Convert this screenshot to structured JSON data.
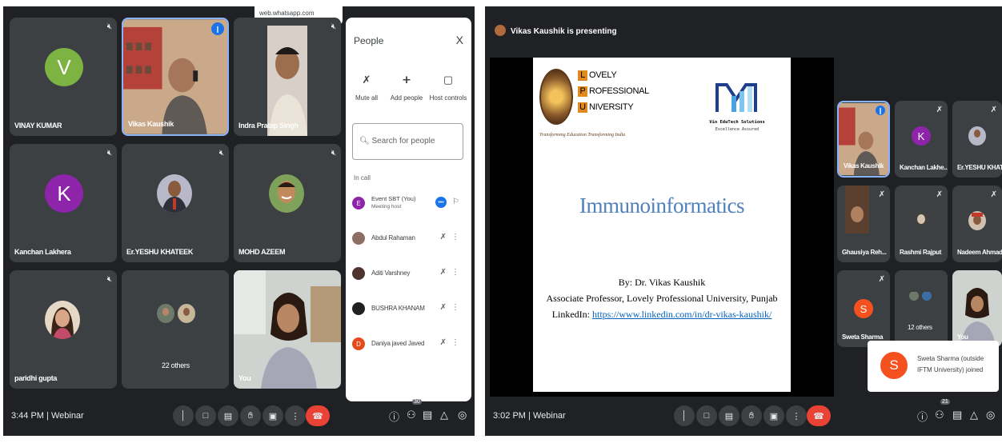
{
  "left": {
    "url_bar": "web.whatsapp.com",
    "tiles": [
      {
        "name": "VINAY KUMAR",
        "initial": "V",
        "color": "#7cb342"
      },
      {
        "name": "Vikas Kaushik"
      },
      {
        "name": "Indra Pratap Singh"
      },
      {
        "name": "Kanchan Lakhera",
        "initial": "K",
        "color": "#8e24aa"
      },
      {
        "name": "Er.YESHU KHATEEK"
      },
      {
        "name": "MOHD AZEEM"
      },
      {
        "name": "paridhi gupta"
      },
      {
        "name": "22 others"
      },
      {
        "name": "You"
      }
    ],
    "people_panel": {
      "title": "People",
      "close": "X",
      "buttons": [
        "Mute all",
        "Add people",
        "Host controls"
      ],
      "search_placeholder": "Search for people",
      "section": "In call",
      "people": [
        {
          "name": "Event SBT (You)",
          "sub": "Meeting host",
          "initial": "E",
          "color": "#8e24aa"
        },
        {
          "name": "Abdul Rahaman"
        },
        {
          "name": "Aditi Varshney"
        },
        {
          "name": "BUSHRA KHANAM"
        },
        {
          "name": "Daniya javed Javed",
          "initial": "D",
          "color": "#e64a19"
        }
      ]
    },
    "bottom": {
      "time": "3:44 PM",
      "sep": "|",
      "title": "Webinar",
      "participants_count": "30"
    }
  },
  "right": {
    "presenting": "Vikas Kaushik is presenting",
    "slide": {
      "lpu_lines": [
        "OVELY",
        "ROFESSIONAL",
        "NIVERSITY"
      ],
      "lpu_letters": [
        "L",
        "P",
        "U"
      ],
      "lpu_tagline": "Transforming Education Transforming India",
      "vin_name": "Vin EduTech Solutions",
      "vin_tagline": "Excellence Assured",
      "title": "Immunoinformatics",
      "by": "By: Dr. Vikas Kaushik",
      "role": "Associate Professor, Lovely Professional University, Punjab",
      "linkedin_label": "LinkedIn: ",
      "linkedin_url": "https://www.linkedin.com/in/dr-vikas-kaushik/"
    },
    "tiles": [
      {
        "name": "Vikas Kaushik"
      },
      {
        "name": "Kanchan Lakhe...",
        "initial": "K",
        "color": "#8e24aa"
      },
      {
        "name": "Er.YESHU KHAT..."
      },
      {
        "name": "Ghausiya Reh..."
      },
      {
        "name": "Rashmi Rajput"
      },
      {
        "name": "Nadeem Ahmad"
      },
      {
        "name": "Sweta Sharma",
        "initial": "S",
        "color": "#f4511e"
      },
      {
        "name": "12 others"
      },
      {
        "name": "You"
      }
    ],
    "notification": {
      "initial": "S",
      "text": "Sweta Sharma (outside IFTM University) joined"
    },
    "bottom": {
      "time": "3:02 PM",
      "sep": "|",
      "title": "Webinar",
      "participants_count": "21"
    }
  }
}
